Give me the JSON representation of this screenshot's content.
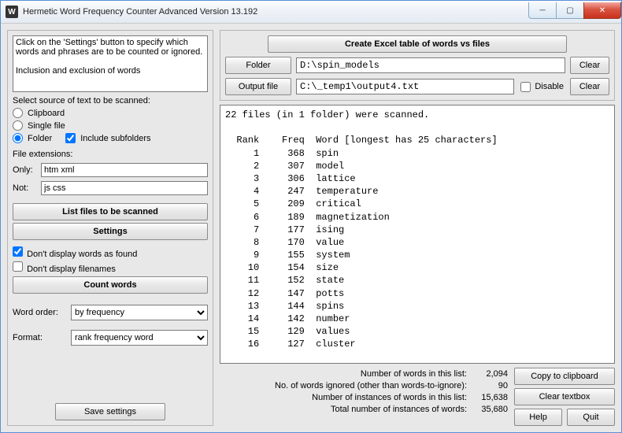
{
  "window": {
    "title": "Hermetic Word Frequency Counter Advanced Version 13.192",
    "icon_letter": "W"
  },
  "left": {
    "help_text": "Click on the 'Settings' button to specify which words and phrases are to be counted or ignored.\n\nInclusion and exclusion of words",
    "source_label": "Select source of text to be scanned:",
    "source": {
      "clipboard": "Clipboard",
      "single_file": "Single file",
      "folder": "Folder",
      "include_subfolders": "Include subfolders"
    },
    "file_ext_label": "File extensions:",
    "only_label": "Only:",
    "only_value": "htm xml",
    "not_label": "Not:",
    "not_value": "js css",
    "list_files_btn": "List files to be scanned",
    "settings_btn": "Settings",
    "dont_display_words": "Don't display words as found",
    "dont_display_filenames": "Don't display filenames",
    "count_words_btn": "Count words",
    "word_order_label": "Word order:",
    "word_order_value": "by frequency",
    "format_label": "Format:",
    "format_value": "rank frequency word",
    "save_settings_btn": "Save settings"
  },
  "right": {
    "excel_btn": "Create Excel table of words vs files",
    "folder_btn": "Folder",
    "folder_value": "D:\\spin_models",
    "output_btn": "Output file",
    "output_value": "C:\\_temp1\\output4.txt",
    "disable_label": "Disable",
    "clear_btn": "Clear",
    "scan_summary": "22 files (in 1 folder) were scanned.",
    "header_line": "  Rank    Freq  Word [longest has 25 characters]",
    "rows": [
      {
        "rank": 1,
        "freq": 368,
        "word": "spin"
      },
      {
        "rank": 2,
        "freq": 307,
        "word": "model"
      },
      {
        "rank": 3,
        "freq": 306,
        "word": "lattice"
      },
      {
        "rank": 4,
        "freq": 247,
        "word": "temperature"
      },
      {
        "rank": 5,
        "freq": 209,
        "word": "critical"
      },
      {
        "rank": 6,
        "freq": 189,
        "word": "magnetization"
      },
      {
        "rank": 7,
        "freq": 177,
        "word": "ising"
      },
      {
        "rank": 8,
        "freq": 170,
        "word": "value"
      },
      {
        "rank": 9,
        "freq": 155,
        "word": "system"
      },
      {
        "rank": 10,
        "freq": 154,
        "word": "size"
      },
      {
        "rank": 11,
        "freq": 152,
        "word": "state"
      },
      {
        "rank": 12,
        "freq": 147,
        "word": "potts"
      },
      {
        "rank": 13,
        "freq": 144,
        "word": "spins"
      },
      {
        "rank": 14,
        "freq": 142,
        "word": "number"
      },
      {
        "rank": 15,
        "freq": 129,
        "word": "values"
      },
      {
        "rank": 16,
        "freq": 127,
        "word": "cluster"
      }
    ],
    "stats": {
      "list_count_label": "Number of words in this list:",
      "list_count": "2,094",
      "ignored_label": "No. of words ignored (other than words-to-ignore):",
      "ignored": "90",
      "instances_list_label": "Number of instances of words in this list:",
      "instances_list": "15,638",
      "instances_total_label": "Total number of instances of words:",
      "instances_total": "35,680"
    },
    "copy_btn": "Copy to clipboard",
    "clear_textbox_btn": "Clear textbox",
    "help_btn": "Help",
    "quit_btn": "Quit"
  }
}
